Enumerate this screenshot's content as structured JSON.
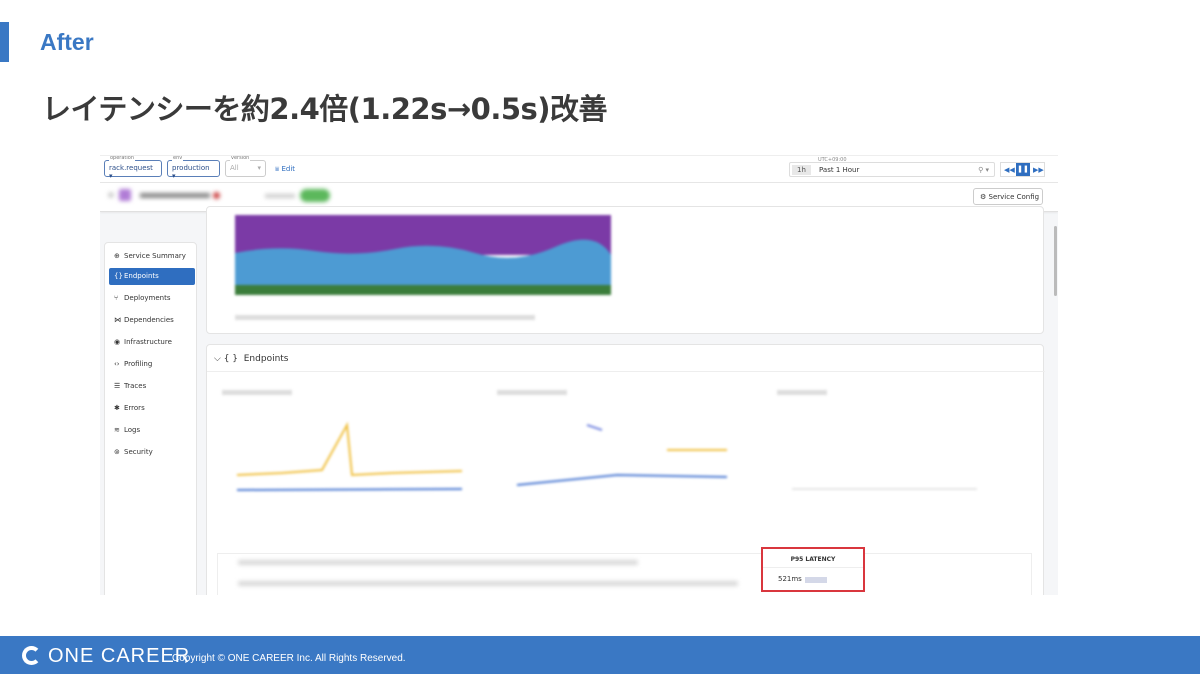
{
  "slide": {
    "label": "After",
    "title": "レイテンシーを約2.4倍(1.22s→0.5s)改善"
  },
  "toolbar": {
    "filters": [
      {
        "label": "operation",
        "value": "rack.request"
      },
      {
        "label": "env",
        "value": "production"
      },
      {
        "label": "version",
        "value": "All"
      }
    ],
    "edit": "Edit",
    "timezone": "UTC+09:00",
    "range_short": "1h",
    "range": "Past 1 Hour",
    "service_config": "Service Config"
  },
  "sidebar": {
    "items": [
      {
        "label": "Service Summary",
        "icon": "globe-icon"
      },
      {
        "label": "Endpoints",
        "icon": "braces-icon",
        "active": true
      },
      {
        "label": "Deployments",
        "icon": "branch-icon"
      },
      {
        "label": "Dependencies",
        "icon": "graph-icon"
      },
      {
        "label": "Infrastructure",
        "icon": "server-icon"
      },
      {
        "label": "Profiling",
        "icon": "code-icon"
      },
      {
        "label": "Traces",
        "icon": "traces-icon"
      },
      {
        "label": "Errors",
        "icon": "bug-icon"
      },
      {
        "label": "Logs",
        "icon": "logs-icon"
      },
      {
        "label": "Security",
        "icon": "shield-icon"
      }
    ]
  },
  "endpoints": {
    "title": "Endpoints",
    "braces": "{ }",
    "column_highlight": "P95 LATENCY",
    "row_value": "521ms"
  },
  "colors": {
    "accent": "#3a78c4",
    "purple": "#7b3aa6",
    "blue": "#4d9bd3",
    "green": "#3b7d3b",
    "highlight": "#d9363e"
  },
  "footer": {
    "brand": "ONE CAREER",
    "copyright": "Copyright © ONE CAREER Inc. All Rights Reserved."
  }
}
